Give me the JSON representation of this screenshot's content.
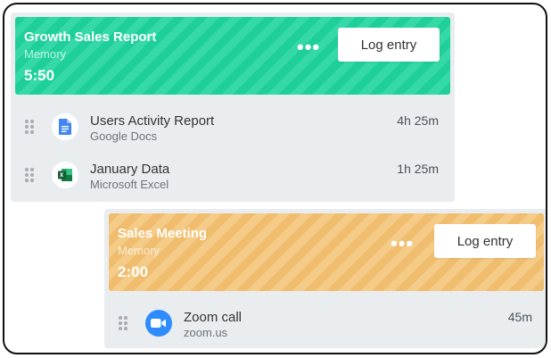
{
  "entries": [
    {
      "header": {
        "title": "Growth Sales Report",
        "subtitle": "Memory",
        "time": "5:50",
        "more_label": "•••",
        "button_label": "Log entry",
        "color": "#1ecf9a"
      },
      "items": [
        {
          "title": "Users Activity Report",
          "subtitle": "Google Docs",
          "duration": "4h 25m",
          "icon": "google-docs-icon"
        },
        {
          "title": "January Data",
          "subtitle": "Microsoft Excel",
          "duration": "1h 25m",
          "icon": "excel-icon"
        }
      ]
    },
    {
      "header": {
        "title": "Sales Meeting",
        "subtitle": "Memory",
        "time": "2:00",
        "more_label": "•••",
        "button_label": "Log entry",
        "color": "#f0bd6e"
      },
      "items": [
        {
          "title": "Zoom call",
          "subtitle": "zoom.us",
          "duration": "45m",
          "icon": "zoom-icon"
        }
      ]
    }
  ]
}
